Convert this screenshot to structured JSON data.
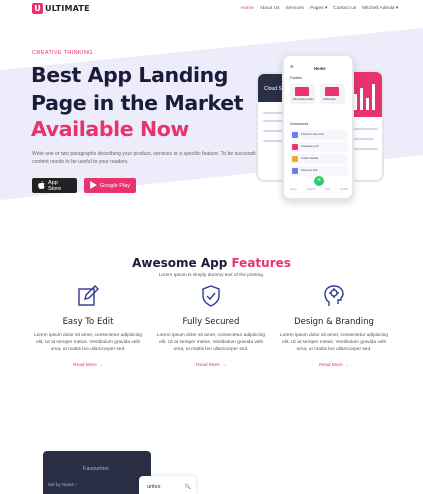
{
  "brand": {
    "mark": "U",
    "name": "ULTIMATE",
    "accent": "#e8336e",
    "dark": "#1c1c3a"
  },
  "nav": {
    "items": [
      {
        "label": "Home",
        "active": true
      },
      {
        "label": "About Us"
      },
      {
        "label": "Services"
      },
      {
        "label": "Pages ▾"
      },
      {
        "label": "Contact us"
      },
      {
        "label": "Mitchell Adeola ▾"
      }
    ]
  },
  "hero": {
    "tagline": "CREATIVE THINKING",
    "headline_line1": "Best App Landing",
    "headline_line2": "Page in the Market",
    "headline_line3": "Available Now",
    "description": "Write one or two paragraphs describing your product, services or a specific feature. To be successful your content needs to be useful to your readers.",
    "btn_appstore": "App Store",
    "btn_googleplay": "Google Play",
    "bg_color": "#ececfb"
  },
  "phone": {
    "top": "Home",
    "folders": "Folders",
    "folder1": "Edit Folder Folder",
    "folder2": "Office Files",
    "docs": "Documents",
    "doc1": "Product Index Doc",
    "doc2": "Catalogue.pdf",
    "doc3": "Folder Details",
    "doc4": "Payment Doc",
    "tabs": [
      "Home",
      "Search",
      "Files",
      "Profile"
    ],
    "left_text": "Cloud S",
    "fab": "+"
  },
  "features": {
    "title_main": "Awesome App ",
    "title_accent": "Features",
    "subtitle": "Lorem Ipsum is simply dummy text of the printing.",
    "items": [
      {
        "icon": "pencil-edit-icon",
        "title": "Easy To Edit",
        "desc": "Lorem ipsum dolor sit amet, consectetur adipiscing elit. Ut at semper metus. Vestibulum gravida velit urna, ut mattis leo ullamcorper sed.",
        "link": "Read More →"
      },
      {
        "icon": "shield-check-icon",
        "title": "Fully Secured",
        "desc": "Lorem ipsum dolor sit amet, consectetur adipiscing elit. Ut at semper metus. Vestibulum gravida velit urna, ut mattis leo ullamcorper sed.",
        "link": "Read More →"
      },
      {
        "icon": "head-brain-icon",
        "title": "Design & Branding",
        "desc": "Lorem ipsum dolor sit amet, consectetur adipiscing elit. Ut at semper metus. Vestibulum gravida velit urna, ut mattis leo ullamcorper sed.",
        "link": "Read More →"
      }
    ]
  },
  "preview": {
    "title": "Favourites",
    "label": "Set by Name ↑",
    "card_title": "urites",
    "card_search": "🔍"
  }
}
